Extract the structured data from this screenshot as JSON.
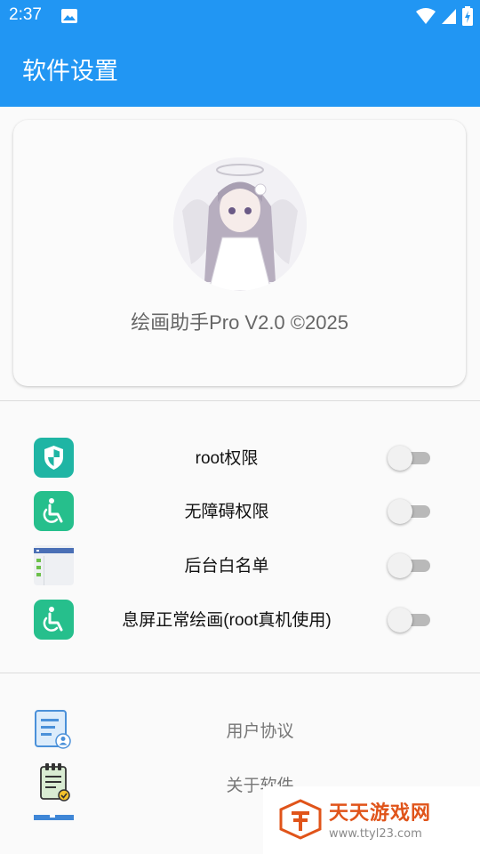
{
  "status_bar": {
    "time": "2:37"
  },
  "app_bar": {
    "title": "软件设置"
  },
  "profile": {
    "version_text": "绘画助手Pro V2.0 ©2025"
  },
  "settings": [
    {
      "label": "root权限",
      "icon": "shield-icon",
      "enabled": false
    },
    {
      "label": "无障碍权限",
      "icon": "accessibility-icon",
      "enabled": false
    },
    {
      "label": "后台白名单",
      "icon": "app-list-icon",
      "enabled": false
    },
    {
      "label": "息屏正常绘画(root真机使用)",
      "icon": "accessibility-icon",
      "enabled": false
    }
  ],
  "menu": [
    {
      "label": "用户协议",
      "icon": "user-agreement-icon"
    },
    {
      "label": "关于软件",
      "icon": "about-clipboard-icon"
    }
  ],
  "watermark": {
    "title": "天天游戏网",
    "url": "www.ttyl23.com"
  },
  "colors": {
    "primary": "#2196f3",
    "icon_green": "#26bf8c",
    "icon_teal": "#1fb5a4"
  }
}
